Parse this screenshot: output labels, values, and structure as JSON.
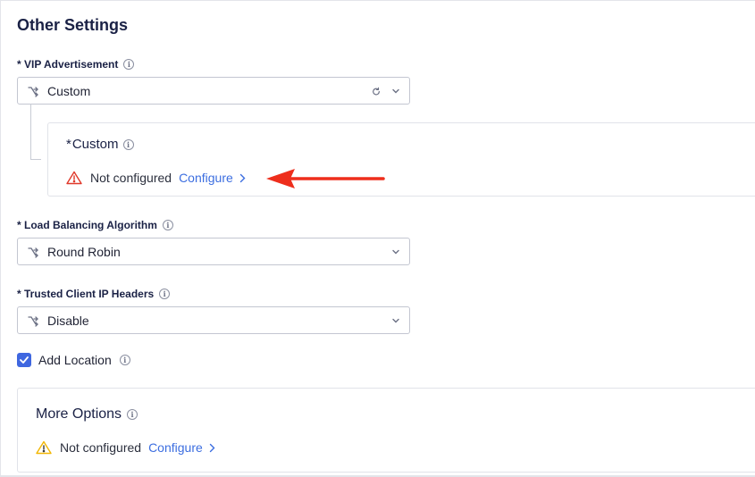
{
  "section_title": "Other Settings",
  "vip": {
    "label": "* VIP Advertisement",
    "value": "Custom",
    "custom_panel": {
      "asterisk": "*",
      "title": "Custom",
      "status": "Not configured",
      "configure_label": "Configure",
      "status_color": "#e0392b"
    }
  },
  "load_balancing": {
    "label": "* Load Balancing Algorithm",
    "value": "Round Robin"
  },
  "trusted_headers": {
    "label": "* Trusted Client IP Headers",
    "value": "Disable"
  },
  "add_location": {
    "label": "Add Location",
    "checked": true
  },
  "more_options": {
    "title": "More Options",
    "status": "Not configured",
    "configure_label": "Configure",
    "status_color": "#f2b705"
  },
  "colors": {
    "accent": "#3f67e0",
    "link": "#3c6ee0",
    "annotation_arrow": "#ee2e1c"
  },
  "icons": [
    "info-icon",
    "route-icon",
    "refresh-icon",
    "chevron-down-icon",
    "warning-icon",
    "chevron-right-icon",
    "check-icon"
  ]
}
